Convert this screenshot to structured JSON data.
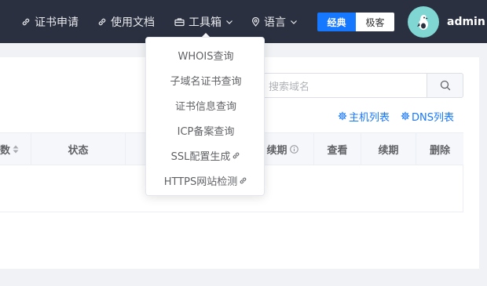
{
  "nav": {
    "apply_label": "证书申请",
    "docs_label": "使用文档",
    "tools_label": "工具箱",
    "lang_label": "语言",
    "mode": {
      "classic": "经典",
      "geek": "极客"
    },
    "username": "admin"
  },
  "tools_menu": [
    {
      "label": "WHOIS查询",
      "external": false
    },
    {
      "label": "子域名证书查询",
      "external": false
    },
    {
      "label": "证书信息查询",
      "external": false
    },
    {
      "label": "ICP备案查询",
      "external": false
    },
    {
      "label": "SSL配置生成",
      "external": true
    },
    {
      "label": "HTTPS网站检测",
      "external": true
    }
  ],
  "search": {
    "placeholder": "搜索域名"
  },
  "links": {
    "hosts": "主机列表",
    "dns": "DNS列表"
  },
  "table": {
    "headers": {
      "count": "数",
      "status": "状态",
      "renew_date": "续期",
      "view": "查看",
      "renew": "续期",
      "delete": "删除"
    }
  },
  "colors": {
    "topbar": "#2a3040",
    "accent": "#1677ff",
    "avatar_bg": "#7fd6d2"
  }
}
